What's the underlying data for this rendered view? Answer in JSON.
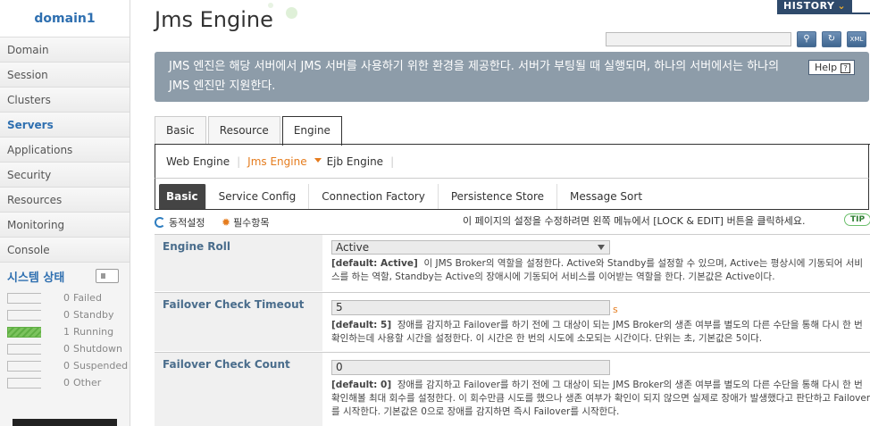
{
  "sidebar": {
    "domain": "domain1",
    "items": [
      {
        "label": "Domain"
      },
      {
        "label": "Session"
      },
      {
        "label": "Clusters"
      },
      {
        "label": "Servers"
      },
      {
        "label": "Applications"
      },
      {
        "label": "Security"
      },
      {
        "label": "Resources"
      },
      {
        "label": "Monitoring"
      },
      {
        "label": "Console"
      }
    ],
    "active_item": "Servers",
    "system_status": {
      "title": "시스템 상태",
      "icon": "monitor-icon",
      "rows": [
        {
          "count": "0",
          "label": "Failed"
        },
        {
          "count": "0",
          "label": "Standby"
        },
        {
          "count": "1",
          "label": "Running"
        },
        {
          "count": "0",
          "label": "Shutdown"
        },
        {
          "count": "0",
          "label": "Suspended"
        },
        {
          "count": "0",
          "label": "Other"
        }
      ]
    }
  },
  "header": {
    "title": "Jms Engine",
    "history_label": "HISTORY",
    "search_placeholder": "",
    "tool_icons": [
      "search-icon",
      "refresh-icon",
      "xml-icon"
    ],
    "xml_label": "XML"
  },
  "banner": {
    "text": "JMS 엔진은 해당 서버에서 JMS 서버를 사용하기 위한 환경을 제공한다. 서버가 부팅될 때 실행되며, 하나의 서버에서는 하나의 JMS 엔진만 지원한다.",
    "help_label": "Help",
    "help_q": "?"
  },
  "tabs": [
    {
      "label": "Basic"
    },
    {
      "label": "Resource"
    },
    {
      "label": "Engine"
    }
  ],
  "active_tab": "Engine",
  "subnav": {
    "items": [
      {
        "label": "Web Engine"
      },
      {
        "label": "Jms Engine"
      },
      {
        "label": "Ejb Engine"
      }
    ],
    "active": "Jms Engine"
  },
  "subtabs": [
    {
      "label": "Basic"
    },
    {
      "label": "Service Config"
    },
    {
      "label": "Connection Factory"
    },
    {
      "label": "Persistence Store"
    },
    {
      "label": "Message Sort"
    }
  ],
  "active_subtab": "Basic",
  "toolbar": {
    "dynamic_label": "동적설정",
    "required_label": "필수항목",
    "notice": "이 페이지의 설정을 수정하려면 왼쪽 메뉴에서 [LOCK & EDIT] 버튼을 클릭하세요.",
    "tip_label": "TIP"
  },
  "fields": [
    {
      "label": "Engine Roll",
      "value": "Active",
      "default_tag": "[default: Active]",
      "description": "이 JMS Broker의 역할을 설정한다. Active와 Standby를 설정할 수 있으며, Active는 평상시에 기동되어 서비스를 하는 역할, Standby는 Active의 장애시에 기동되어 서비스를 이어받는 역할을 한다. 기본값은 Active이다."
    },
    {
      "label": "Failover Check Timeout",
      "value": "5",
      "unit": "s",
      "default_tag": "[default: 5]",
      "description": "장애를 감지하고 Failover를 하기 전에 그 대상이 되는 JMS Broker의 생존 여부를 별도의 다른 수단을 통해 다시 한 번 확인하는데 사용할 시간을 설정한다. 이 시간은 한 번의 시도에 소모되는 시간이다. 단위는 초, 기본값은 5이다."
    },
    {
      "label": "Failover Check Count",
      "value": "0",
      "default_tag": "[default: 0]",
      "description": "장애를 감지하고 Failover를 하기 전에 그 대상이 되는 JMS Broker의 생존 여부를 별도의 다른 수단을 통해 다시 한 번 확인해볼 최대 회수를 설정한다. 이 회수만큼 시도를 했으나 생존 여부가 확인이 되지 않으면 실제로 장애가 발생했다고 판단하고 Failover를 시작한다. 기본값은 0으로 장애를 감지하면 즉시 Failover를 시작한다."
    }
  ]
}
